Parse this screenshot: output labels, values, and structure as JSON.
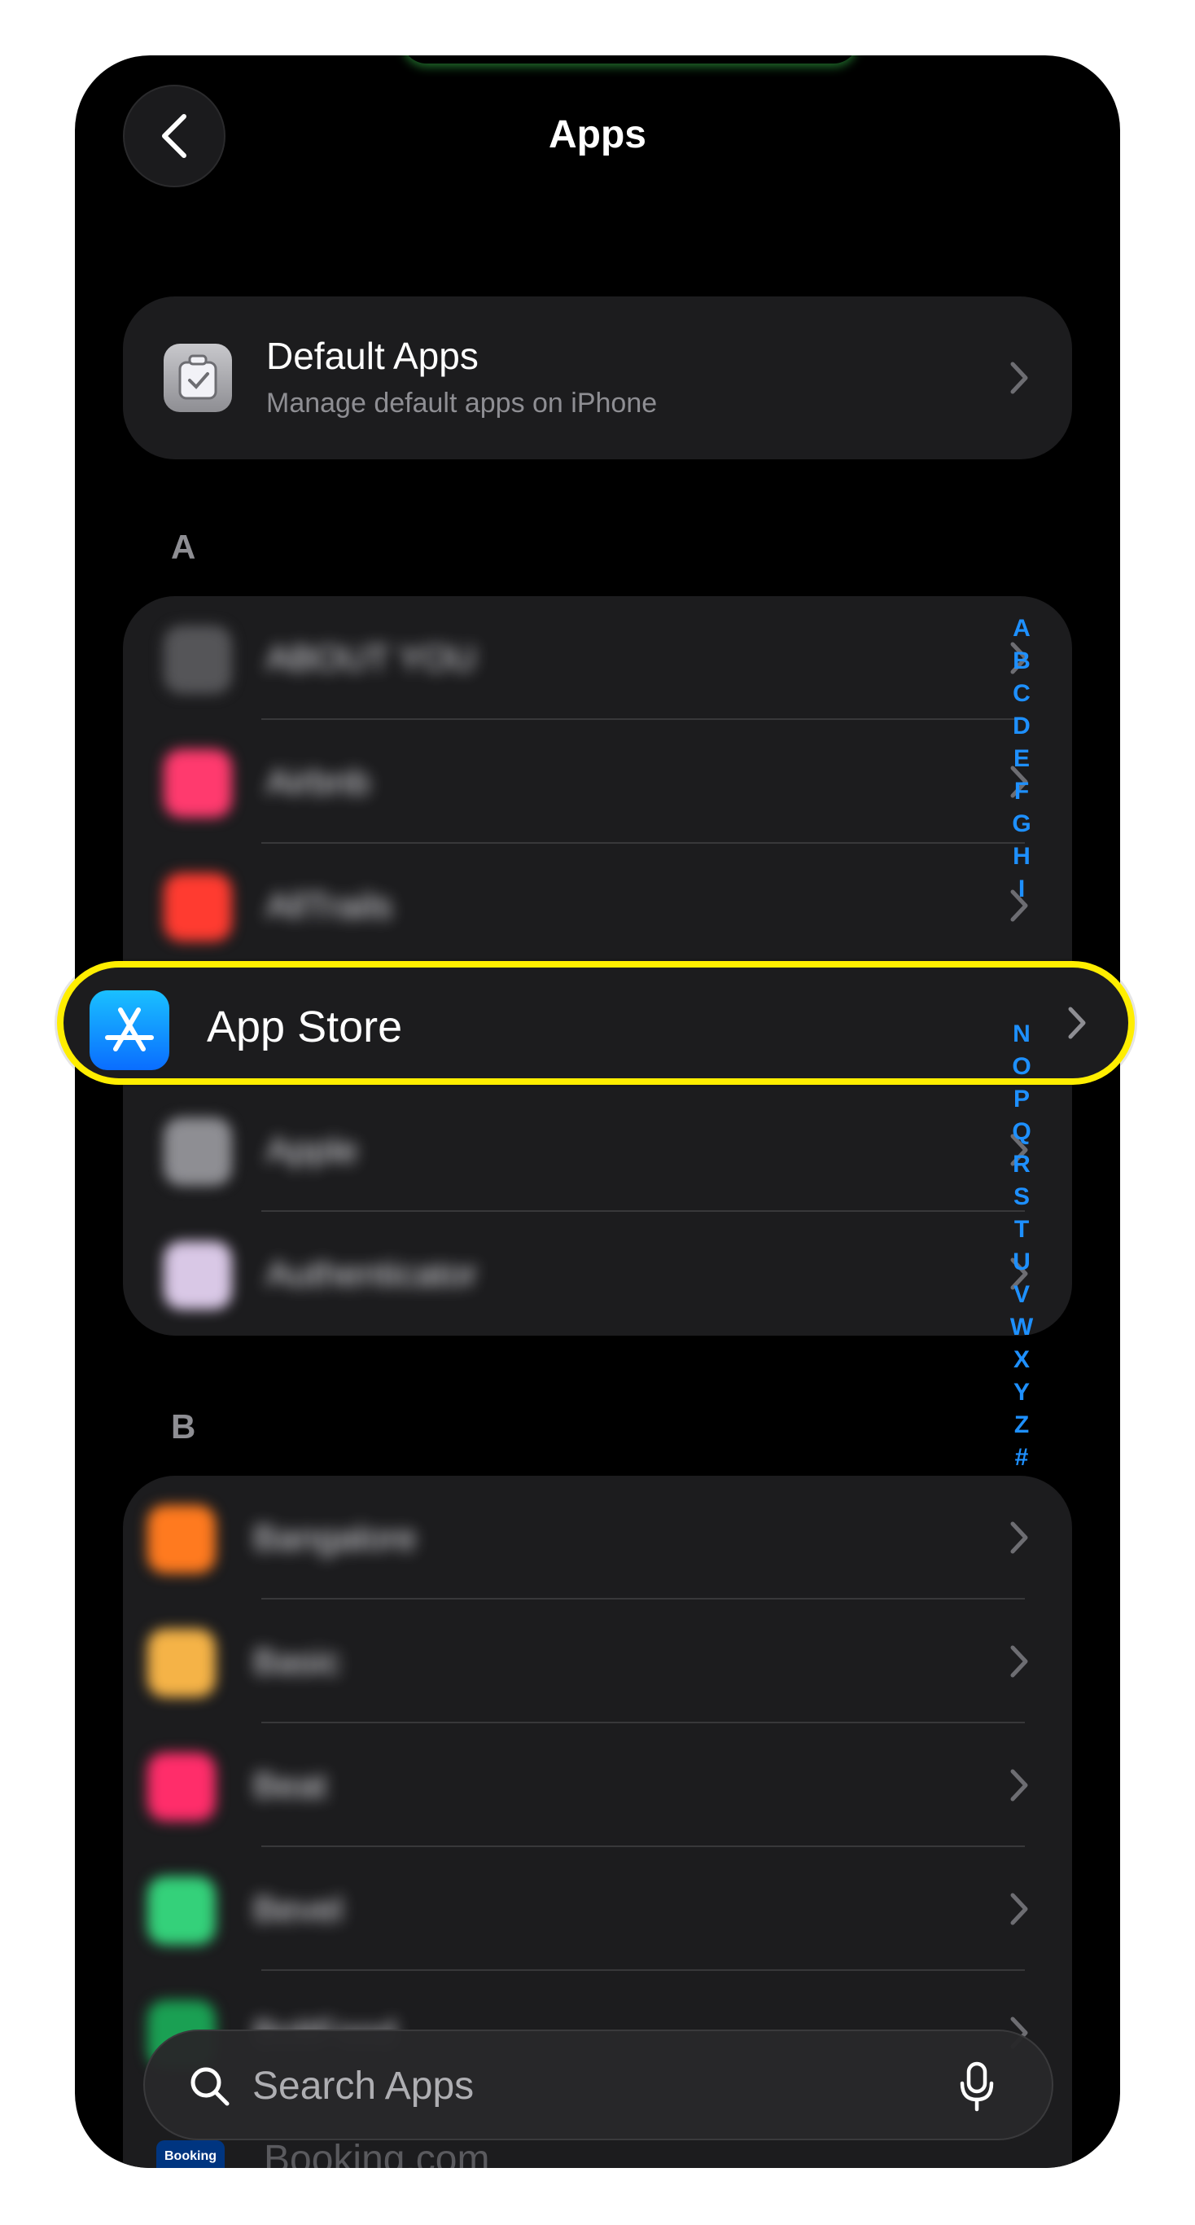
{
  "header": {
    "title": "Apps"
  },
  "default_apps": {
    "title": "Default Apps",
    "subtitle": "Manage default apps on iPhone"
  },
  "section_a": {
    "letter": "A",
    "rows": [
      {
        "label": "ABOUT YOU",
        "icon_color": "#555558"
      },
      {
        "label": "Airbnb",
        "icon_color": "#ff3a6e"
      },
      {
        "label": "AllTrails",
        "icon_color": "#ff3b30"
      },
      {
        "label": "Apple",
        "icon_color": "#8e8e93"
      },
      {
        "label": "Authenticator",
        "icon_color": "#d9c8e6"
      }
    ]
  },
  "highlighted_row": {
    "label": "App Store",
    "icon": "app-store-icon"
  },
  "section_b": {
    "letter": "B",
    "rows": [
      {
        "label": "Bangalore",
        "icon_color": "#ff7a1f"
      },
      {
        "label": "Basic",
        "icon_color": "#f5b347"
      },
      {
        "label": "Beat",
        "icon_color": "#ff2d6a"
      },
      {
        "label": "Bevel",
        "icon_color": "#34d17a"
      },
      {
        "label": "BoltFood",
        "icon_color": "#1aa053"
      }
    ]
  },
  "booking_peek": {
    "label": "Booking.com",
    "icon_text": "Booking"
  },
  "alpha_index": [
    "A",
    "B",
    "C",
    "D",
    "E",
    "F",
    "G",
    "H",
    "I",
    "N",
    "O",
    "P",
    "Q",
    "R",
    "S",
    "T",
    "U",
    "V",
    "W",
    "X",
    "Y",
    "Z",
    "#"
  ],
  "search": {
    "placeholder": "Search Apps"
  },
  "colors": {
    "accent": "#1e90ff",
    "highlight": "#ffee00",
    "card": "#1c1c1e"
  }
}
